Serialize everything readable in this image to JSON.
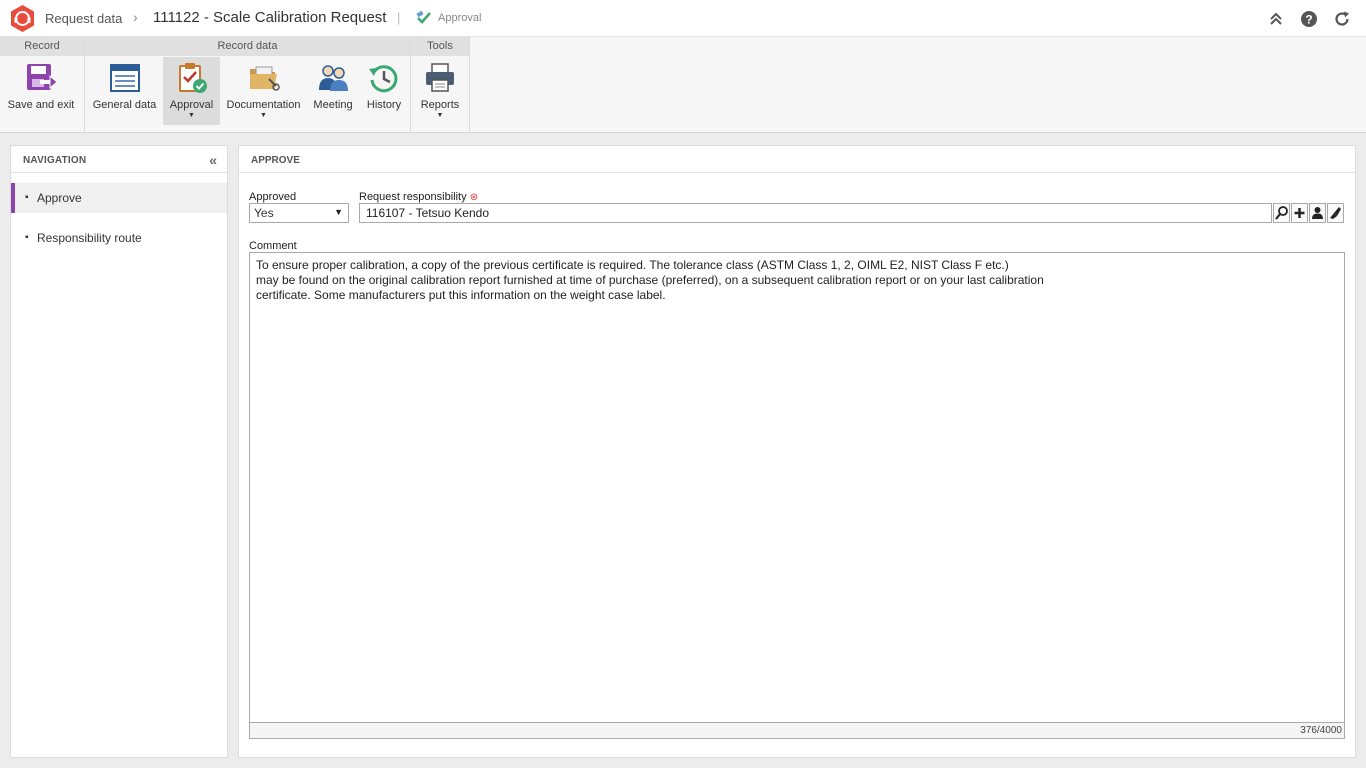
{
  "header": {
    "section": "Request data",
    "record_title": "111122 - Scale Calibration Request",
    "status": "Approval",
    "icons": [
      "logo-icon",
      "chevron-double-up-icon",
      "help-icon",
      "refresh-icon"
    ]
  },
  "ribbon": {
    "groups": [
      {
        "title": "Record"
      },
      {
        "title": "Record data"
      },
      {
        "title": "Tools"
      }
    ],
    "buttons": {
      "save_exit": "Save and exit",
      "general_data": "General data",
      "approval": "Approval",
      "documentation": "Documentation",
      "meeting": "Meeting",
      "history": "History",
      "reports": "Reports"
    },
    "active_button": "Approval"
  },
  "navigation": {
    "title": "NAVIGATION",
    "items": [
      {
        "label": "Approve",
        "active": true
      },
      {
        "label": "Responsibility route",
        "active": false
      }
    ]
  },
  "main": {
    "title": "APPROVE",
    "approved_label": "Approved",
    "approved_value": "Yes",
    "responsibility_label": "Request responsibility",
    "responsibility_value": "116107 - Tetsuo Kendo",
    "comment_label": "Comment",
    "comment_text": "To ensure proper calibration, a copy of the previous certificate is required. The tolerance class (ASTM Class 1, 2, OIML E2, NIST Class F etc.)\nmay be found on the original calibration report furnished at time of purchase (preferred), on a subsequent calibration report or on your last calibration\ncertificate. Some manufacturers put this information on the weight case label.",
    "char_counter": "376/4000"
  },
  "colors": {
    "accent_purple": "#8e44ad",
    "logo_red": "#e74c3c",
    "required_red": "#d9322f",
    "status_green": "#3aa870"
  }
}
